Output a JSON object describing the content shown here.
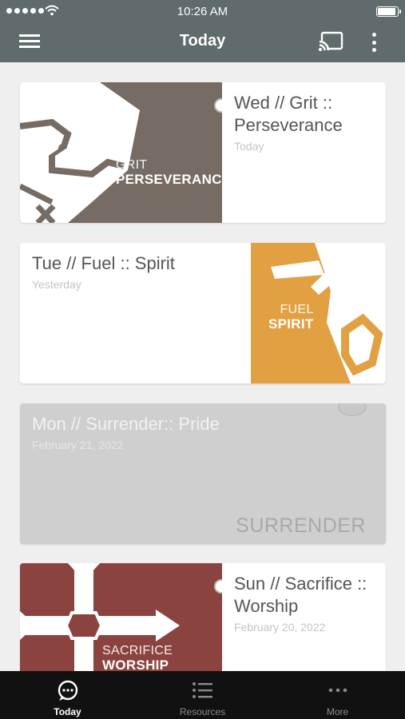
{
  "status_bar": {
    "time": "10:26 AM"
  },
  "header": {
    "title": "Today"
  },
  "cards": [
    {
      "title": "Wed // Grit :: Perseverance",
      "date": "Today",
      "art_line1": "GRIT",
      "art_line2": "PERSEVERANCE",
      "art_color": "#776c63"
    },
    {
      "title": "Tue // Fuel :: Spirit",
      "date": "Yesterday",
      "art_line1": "FUEL",
      "art_line2": "SPIRIT",
      "art_color": "#e1a042"
    },
    {
      "title": "Mon // Surrender:: Pride",
      "date": "February 21, 2022",
      "art_line1": "SURRENDER",
      "art_color": "#cfcfcf"
    },
    {
      "title": "Sun // Sacrifice :: Worship",
      "date": "February 20, 2022",
      "art_line1": "SACRIFICE",
      "art_line2": "WORSHIP",
      "art_color": "#8b433f"
    }
  ],
  "bottom_nav": [
    {
      "label": "Today",
      "icon": "chat-bubble-icon",
      "active": true
    },
    {
      "label": "Resources",
      "icon": "list-icon",
      "active": false
    },
    {
      "label": "More",
      "icon": "more-dots-icon",
      "active": false
    }
  ],
  "colors": {
    "header": "#5f6b6c",
    "background": "#efefef",
    "bottom_nav": "#111111"
  }
}
